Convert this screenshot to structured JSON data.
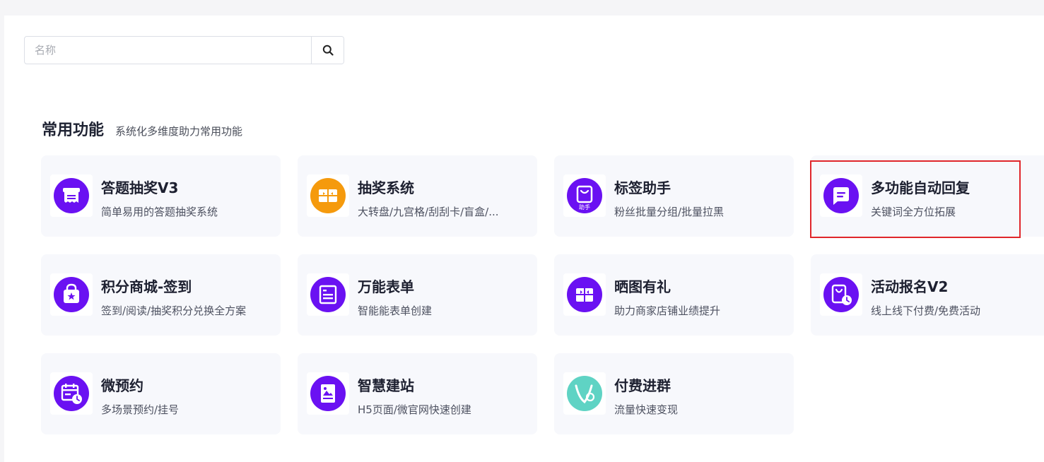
{
  "search": {
    "placeholder": "名称",
    "icon": "search-icon"
  },
  "section": {
    "title": "常用功能",
    "subtitle": "系统化多维度助力常用功能"
  },
  "colors": {
    "purple": "#6a11f2",
    "orange": "#f59a0d",
    "teal": "#5fd3c4",
    "highlight": "#e0262b"
  },
  "cards": [
    {
      "title": "答题抽奖V3",
      "desc": "简单易用的答题抽奖系统",
      "icon": "quiz-lottery-icon"
    },
    {
      "title": "抽奖系统",
      "desc": "大转盘/九宫格/刮刮卡/盲盒/...",
      "icon": "gift-card-icon"
    },
    {
      "title": "标签助手",
      "desc": "粉丝批量分组/批量拉黑",
      "icon": "tag-helper-icon",
      "badge": "助手"
    },
    {
      "title": "多功能自动回复",
      "desc": "关键词全方位拓展",
      "icon": "chat-reply-icon"
    },
    {
      "title": "积分商城-签到",
      "desc": "签到/阅读/抽奖积分兑换全方案",
      "icon": "shopping-bag-icon"
    },
    {
      "title": "万能表单",
      "desc": "智能能表单创建",
      "icon": "form-icon"
    },
    {
      "title": "晒图有礼",
      "desc": "助力商家店铺业绩提升",
      "icon": "gift-icon"
    },
    {
      "title": "活动报名V2",
      "desc": "线上线下付费/免费活动",
      "icon": "signup-clock-icon"
    },
    {
      "title": "微预约",
      "desc": "多场景预约/挂号",
      "icon": "calendar-clock-icon"
    },
    {
      "title": "智慧建站",
      "desc": "H5页面/微官网快速创建",
      "icon": "site-builder-icon"
    },
    {
      "title": "付费进群",
      "desc": "流量快速变现",
      "icon": "paid-group-icon"
    }
  ]
}
